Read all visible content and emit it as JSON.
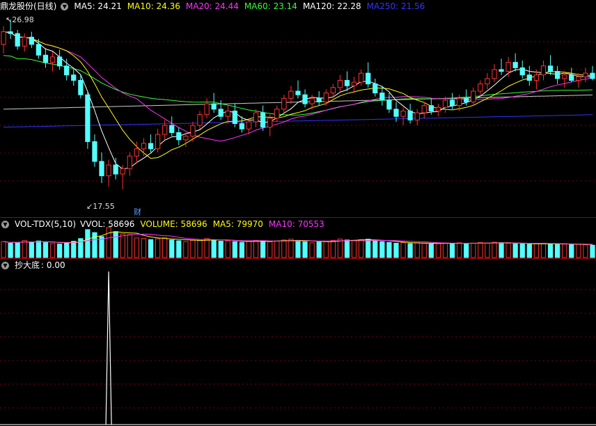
{
  "main": {
    "title": "鼎龙股份(日线)",
    "ma": [
      {
        "label": "MA5: 24.21",
        "color": "#ffffff"
      },
      {
        "label": "MA10: 24.36",
        "color": "#ffff00"
      },
      {
        "label": "MA20: 24.44",
        "color": "#ff33ff"
      },
      {
        "label": "MA60: 23.14",
        "color": "#33ff33"
      },
      {
        "label": "MA120: 22.28",
        "color": "#ffffff"
      },
      {
        "label": "MA250: 21.56",
        "color": "#3333ff"
      }
    ],
    "high_label": "26.98",
    "low_label": "17.55",
    "cai_label": "财"
  },
  "volume": {
    "name": "VOL-TDX(5,10)",
    "items": [
      {
        "label": "VVOL: 58696",
        "color": "#ffffff"
      },
      {
        "label": "VOLUME: 58696",
        "color": "#ffff00"
      },
      {
        "label": "MA5: 79970",
        "color": "#ffff00"
      },
      {
        "label": "MA10: 70553",
        "color": "#ff33ff"
      }
    ]
  },
  "indicator": {
    "name": "抄大底",
    "value": ": 0.00"
  },
  "colors": {
    "up": "#ff3232",
    "down": "#54ffff",
    "grid": "#7a0000",
    "background": "#000000"
  },
  "chart_data": {
    "type": "candlestick",
    "price_range": [
      17.55,
      26.98
    ],
    "ohlc": [
      [
        25.6,
        26.6,
        25.1,
        26.3
      ],
      [
        26.3,
        26.98,
        25.9,
        26.2
      ],
      [
        26.2,
        26.4,
        25.3,
        25.5
      ],
      [
        25.5,
        26.2,
        25.2,
        26.0
      ],
      [
        26.0,
        26.3,
        25.4,
        25.6
      ],
      [
        25.6,
        25.9,
        24.8,
        25.0
      ],
      [
        25.0,
        25.4,
        24.3,
        24.6
      ],
      [
        24.6,
        25.2,
        24.1,
        24.9
      ],
      [
        24.9,
        25.3,
        24.2,
        24.4
      ],
      [
        24.4,
        24.8,
        23.6,
        23.9
      ],
      [
        23.9,
        24.3,
        23.3,
        23.6
      ],
      [
        23.6,
        23.9,
        22.6,
        22.8
      ],
      [
        22.8,
        23.0,
        19.8,
        20.2
      ],
      [
        20.2,
        20.6,
        18.8,
        19.1
      ],
      [
        19.1,
        19.6,
        17.9,
        18.3
      ],
      [
        18.3,
        19.2,
        17.7,
        18.9
      ],
      [
        18.9,
        19.3,
        18.1,
        18.4
      ],
      [
        18.4,
        18.9,
        17.55,
        18.7
      ],
      [
        18.7,
        19.6,
        18.3,
        19.4
      ],
      [
        19.4,
        20.2,
        19.0,
        19.8
      ],
      [
        19.8,
        20.4,
        19.4,
        20.1
      ],
      [
        20.1,
        20.6,
        19.6,
        19.8
      ],
      [
        19.8,
        20.9,
        19.6,
        20.6
      ],
      [
        20.6,
        21.4,
        20.3,
        21.1
      ],
      [
        21.1,
        21.6,
        20.5,
        20.7
      ],
      [
        20.7,
        21.0,
        20.0,
        20.3
      ],
      [
        20.3,
        20.7,
        19.9,
        20.5
      ],
      [
        20.5,
        21.3,
        20.2,
        21.1
      ],
      [
        21.1,
        21.9,
        20.9,
        21.7
      ],
      [
        21.7,
        22.6,
        21.5,
        22.3
      ],
      [
        22.3,
        22.9,
        21.8,
        22.0
      ],
      [
        22.0,
        22.5,
        21.4,
        21.6
      ],
      [
        21.6,
        22.2,
        21.2,
        21.9
      ],
      [
        21.9,
        22.3,
        21.0,
        21.2
      ],
      [
        21.2,
        21.6,
        20.7,
        20.9
      ],
      [
        20.9,
        21.5,
        20.6,
        21.3
      ],
      [
        21.3,
        22.0,
        21.0,
        21.8
      ],
      [
        21.8,
        22.2,
        20.8,
        21.0
      ],
      [
        21.0,
        21.7,
        20.5,
        21.5
      ],
      [
        21.5,
        22.2,
        21.3,
        22.0
      ],
      [
        22.0,
        22.8,
        21.8,
        22.6
      ],
      [
        22.6,
        23.3,
        22.3,
        23.0
      ],
      [
        23.0,
        23.6,
        22.6,
        22.8
      ],
      [
        22.8,
        23.1,
        22.1,
        22.3
      ],
      [
        22.3,
        22.8,
        22.0,
        22.6
      ],
      [
        22.6,
        23.0,
        22.2,
        22.4
      ],
      [
        22.4,
        23.1,
        22.2,
        22.9
      ],
      [
        22.9,
        23.4,
        22.6,
        23.2
      ],
      [
        23.2,
        23.9,
        22.9,
        23.6
      ],
      [
        23.6,
        24.1,
        23.0,
        23.3
      ],
      [
        23.3,
        23.8,
        22.9,
        23.5
      ],
      [
        23.5,
        24.2,
        23.3,
        24.0
      ],
      [
        24.0,
        24.6,
        23.2,
        23.4
      ],
      [
        23.4,
        23.7,
        22.7,
        22.9
      ],
      [
        22.9,
        23.3,
        22.2,
        22.5
      ],
      [
        22.5,
        22.9,
        21.8,
        22.0
      ],
      [
        22.0,
        22.4,
        21.3,
        21.6
      ],
      [
        21.6,
        22.1,
        21.1,
        21.9
      ],
      [
        21.9,
        22.3,
        21.2,
        21.4
      ],
      [
        21.4,
        22.0,
        21.1,
        21.8
      ],
      [
        21.8,
        22.4,
        21.5,
        22.2
      ],
      [
        22.2,
        22.6,
        21.7,
        21.9
      ],
      [
        21.9,
        22.3,
        21.6,
        22.1
      ],
      [
        22.1,
        22.7,
        21.8,
        22.5
      ],
      [
        22.5,
        22.9,
        22.0,
        22.2
      ],
      [
        22.2,
        22.8,
        21.9,
        22.6
      ],
      [
        22.6,
        23.1,
        22.2,
        22.4
      ],
      [
        22.4,
        23.2,
        22.2,
        23.0
      ],
      [
        23.0,
        23.6,
        22.8,
        23.4
      ],
      [
        23.4,
        24.0,
        23.1,
        23.7
      ],
      [
        23.7,
        24.5,
        23.5,
        24.2
      ],
      [
        24.2,
        24.8,
        23.9,
        24.1
      ],
      [
        24.1,
        24.9,
        23.8,
        24.6
      ],
      [
        24.6,
        25.1,
        24.1,
        24.3
      ],
      [
        24.3,
        24.7,
        23.7,
        23.9
      ],
      [
        23.9,
        24.4,
        23.3,
        23.6
      ],
      [
        23.6,
        24.2,
        23.1,
        23.9
      ],
      [
        23.9,
        24.7,
        23.6,
        24.4
      ],
      [
        24.4,
        25.0,
        23.9,
        24.1
      ],
      [
        24.1,
        24.4,
        23.4,
        23.7
      ],
      [
        23.7,
        24.1,
        23.2,
        23.9
      ],
      [
        23.9,
        24.3,
        23.5,
        23.6
      ],
      [
        23.6,
        24.0,
        23.2,
        23.8
      ],
      [
        23.8,
        24.3,
        23.5,
        24.0
      ],
      [
        24.0,
        24.4,
        23.6,
        23.7
      ]
    ],
    "volume": [
      80,
      72,
      75,
      85,
      78,
      83,
      76,
      70,
      68,
      75,
      82,
      95,
      140,
      125,
      105,
      150,
      130,
      118,
      115,
      98,
      96,
      90,
      94,
      100,
      88,
      84,
      80,
      86,
      90,
      95,
      88,
      82,
      84,
      80,
      76,
      81,
      86,
      84,
      79,
      83,
      88,
      92,
      86,
      79,
      74,
      78,
      82,
      86,
      93,
      88,
      84,
      90,
      92,
      85,
      80,
      76,
      72,
      75,
      70,
      74,
      72,
      68,
      70,
      73,
      71,
      74,
      69,
      72,
      75,
      73,
      77,
      74,
      71,
      70,
      68,
      66,
      70,
      72,
      68,
      66,
      67,
      65,
      68,
      64,
      62
    ],
    "indicator_values": [
      0,
      0,
      0,
      0,
      0,
      0,
      0,
      0,
      0,
      0,
      0,
      0,
      0,
      0,
      0,
      1,
      0,
      0,
      0,
      0,
      0,
      0,
      0,
      0,
      0,
      0,
      0,
      0,
      0,
      0,
      0,
      0,
      0,
      0,
      0,
      0,
      0,
      0,
      0,
      0,
      0,
      0,
      0,
      0,
      0,
      0,
      0,
      0,
      0,
      0,
      0,
      0,
      0,
      0,
      0,
      0,
      0,
      0,
      0,
      0,
      0,
      0,
      0,
      0,
      0,
      0,
      0,
      0,
      0,
      0,
      0,
      0,
      0,
      0,
      0,
      0,
      0,
      0,
      0,
      0,
      0,
      0,
      0,
      0,
      0
    ]
  }
}
